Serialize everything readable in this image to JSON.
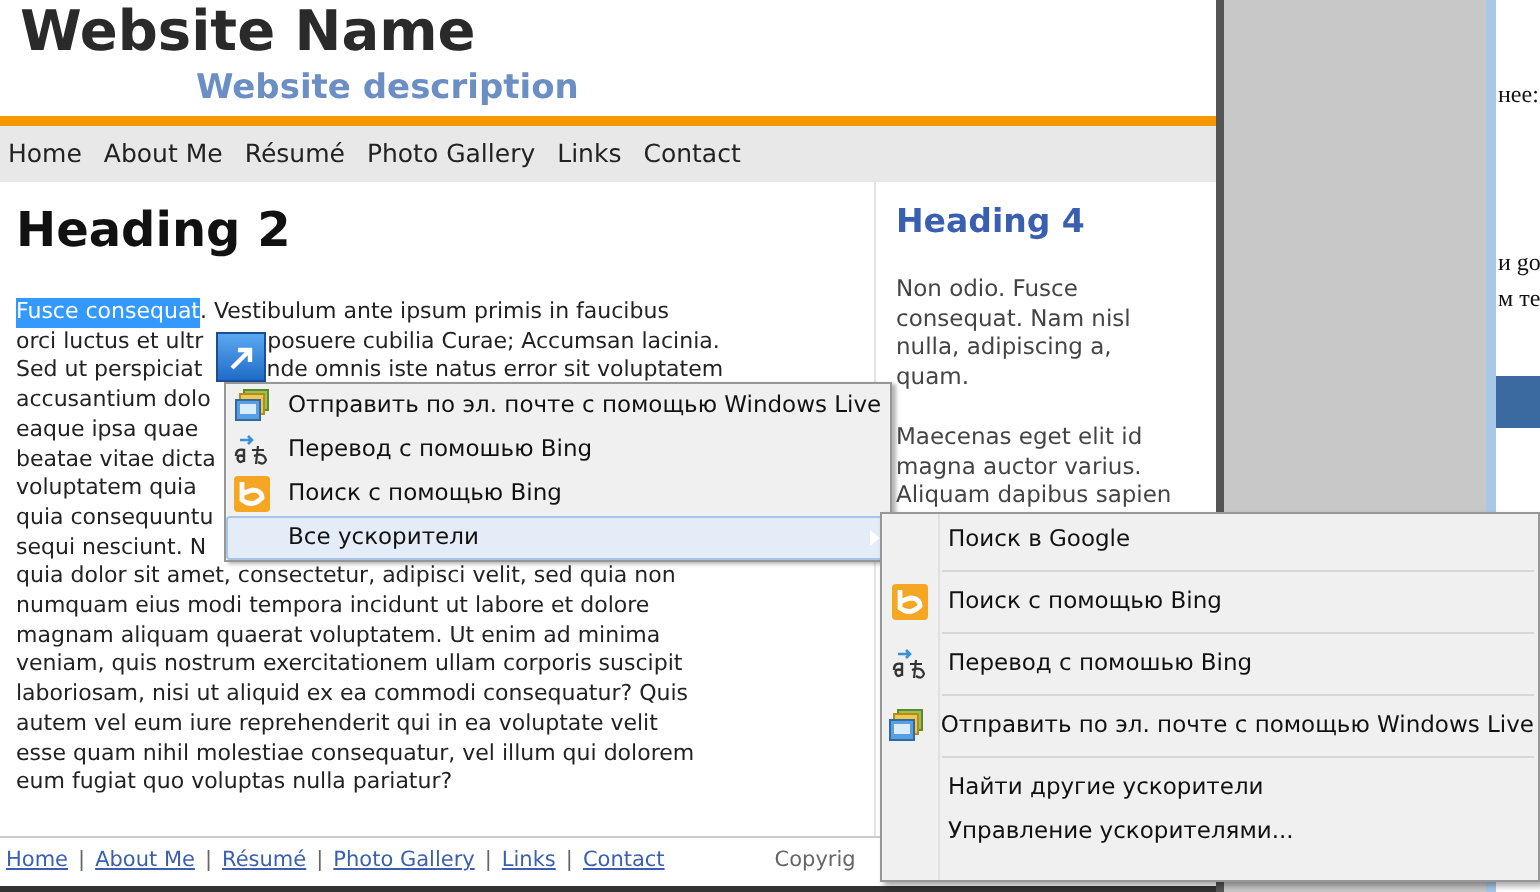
{
  "header": {
    "site_name": "Website Name",
    "site_description": "Website description"
  },
  "nav": [
    "Home",
    "About Me",
    "Résumé",
    "Photo Gallery",
    "Links",
    "Contact"
  ],
  "main": {
    "heading": "Heading 2",
    "lines": [
      {
        "segments": [
          {
            "text": "Fusce consequat",
            "selected": true
          },
          {
            "text": ". Vestibulum ante ipsum primis in faucibus",
            "selected": false
          }
        ]
      },
      {
        "segments": [
          {
            "text": "orci luctus et ultr",
            "selected": false
          },
          {
            "text": "posuere cubilia Curae; Accumsan lacinia.",
            "selected": false,
            "after_gap": true
          }
        ]
      },
      {
        "segments": [
          {
            "text": "Sed ut perspiciat",
            "selected": false
          },
          {
            "text": "nde omnis iste natus error sit voluptatem",
            "selected": false,
            "after_gap": true
          }
        ]
      },
      {
        "segments": [
          {
            "text": "accusantium dolo",
            "selected": false
          }
        ]
      },
      {
        "segments": [
          {
            "text": "eaque ipsa quae",
            "selected": false
          }
        ]
      },
      {
        "segments": [
          {
            "text": "beatae vitae dicta",
            "selected": false
          }
        ]
      },
      {
        "segments": [
          {
            "text": "voluptatem quia",
            "selected": false
          }
        ]
      },
      {
        "segments": [
          {
            "text": "quia consequuntu",
            "selected": false
          }
        ]
      },
      {
        "segments": [
          {
            "text": "sequi nesciunt. N",
            "selected": false
          }
        ]
      },
      {
        "segments": [
          {
            "text": "quia dolor sit amet, consectetur, adipisci velit, sed quia non",
            "selected": false
          }
        ]
      },
      {
        "segments": [
          {
            "text": "numquam eius modi tempora incidunt ut labore et dolore",
            "selected": false
          }
        ]
      },
      {
        "segments": [
          {
            "text": "magnam aliquam quaerat voluptatem. Ut enim ad minima",
            "selected": false
          }
        ]
      },
      {
        "segments": [
          {
            "text": "veniam, quis nostrum exercitationem ullam corporis suscipit",
            "selected": false
          }
        ]
      },
      {
        "segments": [
          {
            "text": "laboriosam, nisi ut aliquid ex ea commodi consequatur? Quis",
            "selected": false
          }
        ]
      },
      {
        "segments": [
          {
            "text": "autem vel eum iure reprehenderit qui in ea voluptate velit",
            "selected": false
          }
        ]
      },
      {
        "segments": [
          {
            "text": "esse quam nihil molestiae consequatur, vel illum qui dolorem",
            "selected": false
          }
        ]
      },
      {
        "segments": [
          {
            "text": "eum fugiat quo voluptas nulla pariatur?",
            "selected": false
          }
        ]
      }
    ]
  },
  "sidebar": {
    "heading": "Heading 4",
    "paragraphs": [
      [
        "Non odio. Fusce",
        "consequat. Nam nisl",
        "nulla, adipiscing a,",
        "quam."
      ],
      [
        "Maecenas eget elit id",
        "magna auctor varius.",
        "Aliquam dapibus sapien"
      ]
    ]
  },
  "footer": {
    "links": [
      "Home",
      "About Me",
      "Résumé",
      "Photo Gallery",
      "Links",
      "Contact"
    ],
    "separator": "|",
    "copyright": "Copyrig"
  },
  "background_window": {
    "texts": [
      "нее:",
      "и go",
      "м те"
    ]
  },
  "accelerator_menu": {
    "items": [
      {
        "kind": "mail",
        "label": "Отправить по эл. почте с помощью Windows Live",
        "selected": false
      },
      {
        "kind": "translate",
        "label": "Перевод с помошью Bing",
        "selected": false
      },
      {
        "kind": "bing",
        "label": "Поиск с помощью Bing",
        "selected": false
      },
      {
        "kind": "submenu",
        "label": "Все ускорители",
        "selected": true
      }
    ]
  },
  "submenu": {
    "groups": [
      [
        {
          "kind": "plain",
          "label": "Поиск в Google"
        }
      ],
      [
        {
          "kind": "bing",
          "label": "Поиск с помощью Bing"
        }
      ],
      [
        {
          "kind": "translate",
          "label": "Перевод с помошью Bing"
        }
      ],
      [
        {
          "kind": "mail",
          "label": "Отправить по эл. почте с помощью Windows Live"
        }
      ],
      [
        {
          "kind": "plain",
          "label": "Найти другие ускорители"
        },
        {
          "kind": "plain",
          "label": "Управление ускорителями..."
        }
      ]
    ]
  }
}
